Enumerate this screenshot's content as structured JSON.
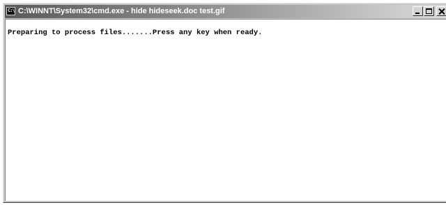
{
  "window": {
    "title": "C:\\WINNT\\System32\\cmd.exe - hide hideseek.doc test.gif",
    "app_icon_text": "C:\\"
  },
  "controls": {
    "minimize": "minimize",
    "maximize": "maximize",
    "close": "close"
  },
  "console": {
    "lines": [
      "Preparing to process files.......Press any key when ready."
    ],
    "background": "#ffffff",
    "text_color": "#000000"
  },
  "colors": {
    "titlebar_start": "#5a5a5a",
    "titlebar_end": "#dcdcdc",
    "title_text": "#ffffff",
    "frame": "#c8c8c8"
  }
}
